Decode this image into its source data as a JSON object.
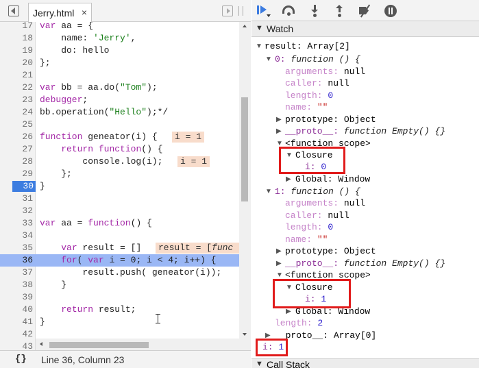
{
  "tab": {
    "title": "Jerry.html",
    "close": "×"
  },
  "editor": {
    "lines": [
      {
        "num": "17",
        "text": "var aa = {"
      },
      {
        "num": "18",
        "text": "    name: 'Jerry',"
      },
      {
        "num": "19",
        "text": "    do: hello"
      },
      {
        "num": "20",
        "text": "};"
      },
      {
        "num": "21",
        "text": ""
      },
      {
        "num": "22",
        "text": "var bb = aa.do(\"Tom\");"
      },
      {
        "num": "23",
        "text": "debugger;"
      },
      {
        "num": "24",
        "text": "bb.operation(\"Hello\");*/"
      },
      {
        "num": "25",
        "text": ""
      },
      {
        "num": "26",
        "text": "function geneator(i) {"
      },
      {
        "num": "27",
        "text": "    return function() {"
      },
      {
        "num": "28",
        "text": "        console.log(i);"
      },
      {
        "num": "29",
        "text": "    };"
      },
      {
        "num": "30",
        "text": "}"
      },
      {
        "num": "31",
        "text": ""
      },
      {
        "num": "32",
        "text": ""
      },
      {
        "num": "33",
        "text": "var aa = function() {"
      },
      {
        "num": "34",
        "text": ""
      },
      {
        "num": "35",
        "text": "    var result = []"
      },
      {
        "num": "36",
        "text": "    for( var i = 0; i < 4; i++) {"
      },
      {
        "num": "37",
        "text": "        result.push( geneator(i));"
      },
      {
        "num": "38",
        "text": "    }"
      },
      {
        "num": "39",
        "text": ""
      },
      {
        "num": "40",
        "text": "    return result;"
      },
      {
        "num": "41",
        "text": "}"
      },
      {
        "num": "42",
        "text": ""
      },
      {
        "num": "43",
        "text": ""
      }
    ],
    "inline_values": {
      "line26": "i = 1",
      "line28": "i = 1",
      "line35_prefix": "result = [",
      "line35_fn": "func"
    }
  },
  "status": {
    "braces": "{}",
    "position": "Line 36, Column 23"
  },
  "watch": {
    "header": "Watch",
    "result_label": "result: Array[2]",
    "item0": {
      "label": "0: ",
      "fn": "function () {",
      "arguments": "arguments: ",
      "arguments_val": "null",
      "caller": "caller: ",
      "caller_val": "null",
      "length": "length: ",
      "length_val": "0",
      "name": "name: ",
      "name_val": "\"\"",
      "prototype": "prototype: Object",
      "proto": "__proto__: ",
      "proto_val": "function Empty() {}",
      "scope": "<function scope>",
      "closure": "Closure",
      "i_label": "i: ",
      "i_val": "0",
      "global": "Global: Window"
    },
    "item1": {
      "label": "1: ",
      "fn": "function () {",
      "arguments": "arguments: ",
      "arguments_val": "null",
      "caller": "caller: ",
      "caller_val": "null",
      "length": "length: ",
      "length_val": "0",
      "name": "name: ",
      "name_val": "\"\"",
      "prototype": "prototype: Object",
      "proto": "__proto__: ",
      "proto_val": "function Empty() {}",
      "scope": "<function scope>",
      "closure": "Closure",
      "i_label": "i: ",
      "i_val": "1",
      "global": "Global: Window"
    },
    "length_label": "length: ",
    "length_val": "2",
    "proto_label": "__proto__: Array[0]",
    "i_watch_label": "i: ",
    "i_watch_val": "1"
  },
  "callstack": {
    "header": "Call Stack"
  },
  "colors": {
    "highlight": "#9ab7f5",
    "breakpoint": "#3d7de0",
    "annotation": "#e11b1b",
    "inline_value": "#f8dccb"
  }
}
